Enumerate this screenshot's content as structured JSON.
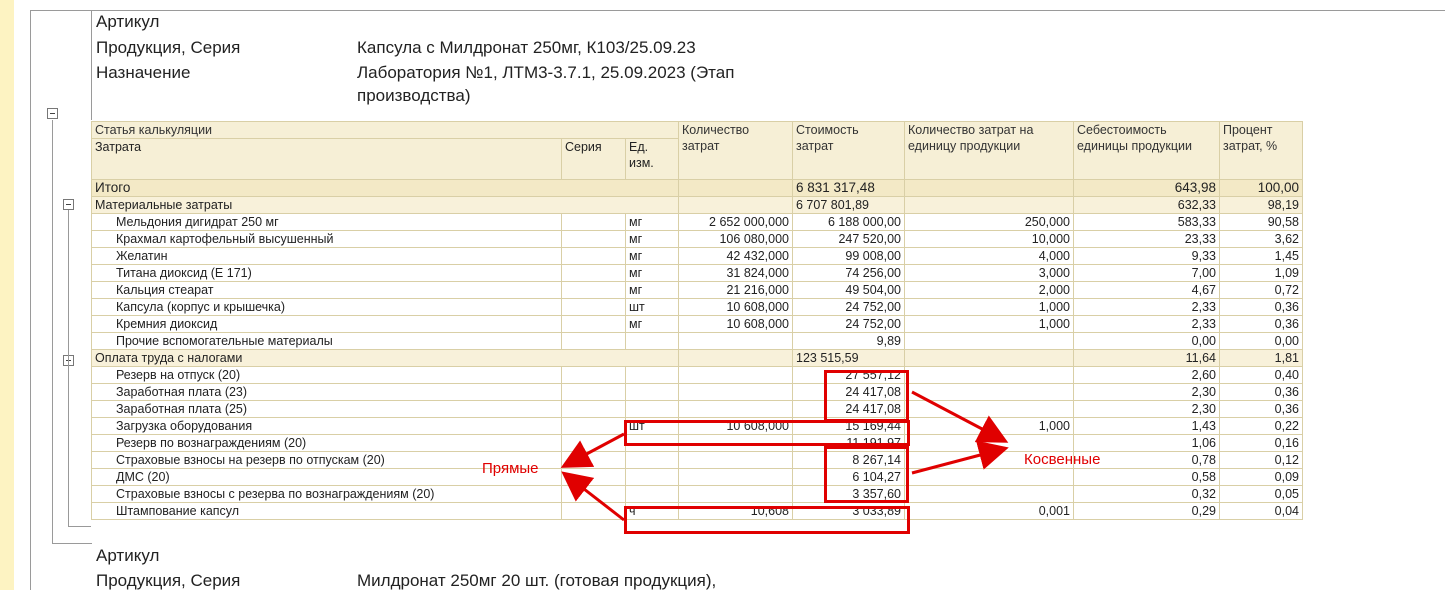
{
  "header1": {
    "article_label": "Артикул",
    "product_label": "Продукция, Серия",
    "product_value": "Капсула с Милдронат 250мг, К103/25.09.23",
    "purpose_label": "Назначение",
    "purpose_value_line1": "Лаборатория №1, ЛТМ3-3.7.1, 25.09.2023 (Этап",
    "purpose_value_line2": "производства)"
  },
  "columns": {
    "article": "Статья калькуляции",
    "cost_item": "Затрата",
    "series": "Серия",
    "unit_l1": "Ед.",
    "unit_l2": "изм.",
    "qty_l1": "Количество",
    "qty_l2": "затрат",
    "cost_l1": "Стоимость",
    "cost_l2": "затрат",
    "qty_per_unit_l1": "Количество затрат на",
    "qty_per_unit_l2": "единицу продукции",
    "unit_cost_l1": "Себестоимость",
    "unit_cost_l2": "единицы продукции",
    "pct_l1": "Процент",
    "pct_l2": "затрат, %"
  },
  "total": {
    "label": "Итого",
    "cost": "6 831 317,48",
    "unit_cost": "643,98",
    "pct": "100,00"
  },
  "groups": [
    {
      "label": "Материальные затраты",
      "cost": "6 707 801,89",
      "unit_cost": "632,33",
      "pct": "98,19",
      "items": [
        {
          "name": "Мельдония дигидрат 250 мг",
          "unit": "мг",
          "qty": "2 652 000,000",
          "cost": "6 188 000,00",
          "qpu": "250,000",
          "uc": "583,33",
          "pct": "90,58"
        },
        {
          "name": "Крахмал картофельный высушенный",
          "unit": "мг",
          "qty": "106 080,000",
          "cost": "247 520,00",
          "qpu": "10,000",
          "uc": "23,33",
          "pct": "3,62"
        },
        {
          "name": "Желатин",
          "unit": "мг",
          "qty": "42 432,000",
          "cost": "99 008,00",
          "qpu": "4,000",
          "uc": "9,33",
          "pct": "1,45"
        },
        {
          "name": "Титана диоксид (Е 171)",
          "unit": "мг",
          "qty": "31 824,000",
          "cost": "74 256,00",
          "qpu": "3,000",
          "uc": "7,00",
          "pct": "1,09"
        },
        {
          "name": "Кальция стеарат",
          "unit": "мг",
          "qty": "21 216,000",
          "cost": "49 504,00",
          "qpu": "2,000",
          "uc": "4,67",
          "pct": "0,72"
        },
        {
          "name": "Капсула (корпус и крышечка)",
          "unit": "шт",
          "qty": "10 608,000",
          "cost": "24 752,00",
          "qpu": "1,000",
          "uc": "2,33",
          "pct": "0,36"
        },
        {
          "name": "Кремния диоксид",
          "unit": "мг",
          "qty": "10 608,000",
          "cost": "24 752,00",
          "qpu": "1,000",
          "uc": "2,33",
          "pct": "0,36"
        },
        {
          "name": "Прочие вспомогательные материалы",
          "unit": "",
          "qty": "",
          "cost": "9,89",
          "qpu": "",
          "uc": "0,00",
          "pct": "0,00"
        }
      ]
    },
    {
      "label": "Оплата труда с налогами",
      "cost": "123 515,59",
      "unit_cost": "11,64",
      "pct": "1,81",
      "items": [
        {
          "name": "Резерв на отпуск (20)",
          "unit": "",
          "qty": "",
          "cost": "27 557,12",
          "qpu": "",
          "uc": "2,60",
          "pct": "0,40"
        },
        {
          "name": "Заработная плата (23)",
          "unit": "",
          "qty": "",
          "cost": "24 417,08",
          "qpu": "",
          "uc": "2,30",
          "pct": "0,36"
        },
        {
          "name": "Заработная плата (25)",
          "unit": "",
          "qty": "",
          "cost": "24 417,08",
          "qpu": "",
          "uc": "2,30",
          "pct": "0,36"
        },
        {
          "name": "Загрузка оборудования",
          "unit": "шт",
          "qty": "10 608,000",
          "cost": "15 169,44",
          "qpu": "1,000",
          "uc": "1,43",
          "pct": "0,22"
        },
        {
          "name": "Резерв по вознаграждениям (20)",
          "unit": "",
          "qty": "",
          "cost": "11 191,97",
          "qpu": "",
          "uc": "1,06",
          "pct": "0,16"
        },
        {
          "name": "Страховые взносы на резерв по отпускам (20)",
          "unit": "",
          "qty": "",
          "cost": "8 267,14",
          "qpu": "",
          "uc": "0,78",
          "pct": "0,12"
        },
        {
          "name": "ДМС (20)",
          "unit": "",
          "qty": "",
          "cost": "6 104,27",
          "qpu": "",
          "uc": "0,58",
          "pct": "0,09"
        },
        {
          "name": "Страховые взносы с резерва по вознаграждениям (20)",
          "unit": "",
          "qty": "",
          "cost": "3 357,60",
          "qpu": "",
          "uc": "0,32",
          "pct": "0,05"
        },
        {
          "name": "Штампование капсул",
          "unit": "ч",
          "qty": "10,608",
          "cost": "3 033,89",
          "qpu": "0,001",
          "uc": "0,29",
          "pct": "0,04"
        }
      ]
    }
  ],
  "annotations": {
    "direct": "Прямые",
    "indirect": "Косвенные"
  },
  "header2": {
    "article_label": "Артикул",
    "product_label": "Продукция, Серия",
    "product_value": "Милдронат 250мг 20 шт. (готовая продукция),"
  },
  "colors": {
    "highlight": "#e00000",
    "header_bg": "#f6efd6",
    "left_strip": "#fdf3c2"
  }
}
